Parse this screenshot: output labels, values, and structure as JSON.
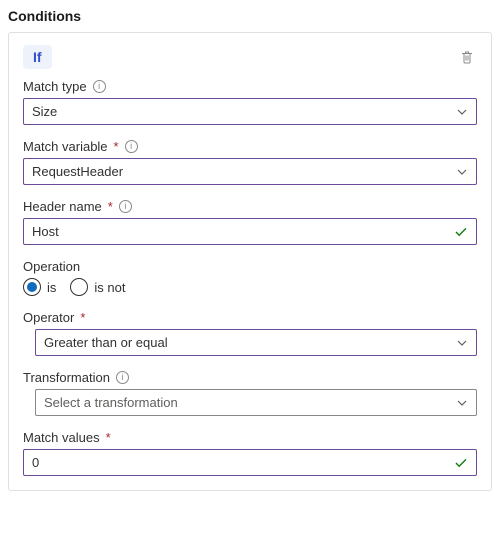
{
  "section_title": "Conditions",
  "pill_label": "If",
  "fields": {
    "match_type": {
      "label": "Match type",
      "value": "Size"
    },
    "match_variable": {
      "label": "Match variable",
      "value": "RequestHeader",
      "required": true
    },
    "header_name": {
      "label": "Header name",
      "value": "Host",
      "required": true
    },
    "operation": {
      "label": "Operation",
      "options": {
        "is": "is",
        "is_not": "is not"
      },
      "selected": "is"
    },
    "operator": {
      "label": "Operator",
      "value": "Greater than or equal",
      "required": true
    },
    "transformation": {
      "label": "Transformation",
      "placeholder": "Select a transformation"
    },
    "match_values": {
      "label": "Match values",
      "value": "0",
      "required": true
    }
  },
  "required_mark": "*"
}
